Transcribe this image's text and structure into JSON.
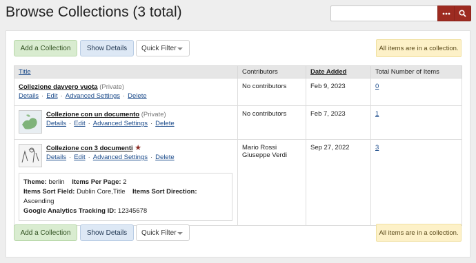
{
  "header": {
    "title": "Browse Collections (3 total)",
    "search_placeholder": "",
    "more_icon": "ellipsis-icon",
    "search_icon": "search-icon",
    "accent": "#9d2b21"
  },
  "toolbar": {
    "add_label": "Add a Collection",
    "show_label": "Show Details",
    "filter_label": "Quick Filter",
    "notice": "All items are in a collection."
  },
  "table": {
    "headers": [
      "Title",
      "Contributors",
      "Date Added",
      "Total Number of Items"
    ],
    "rows": [
      {
        "title": "Collezione davvero vuota",
        "private": "(Private)",
        "actions": [
          "Details",
          "Edit",
          "Advanced Settings",
          "Delete"
        ],
        "contributors": "No contributors",
        "date": "Feb 9, 2023",
        "count": "0"
      },
      {
        "title": "Collezione con un documento",
        "private": "(Private)",
        "actions": [
          "Details",
          "Edit",
          "Advanced Settings",
          "Delete"
        ],
        "contributors": "No contributors",
        "date": "Feb 7, 2023",
        "count": "1"
      },
      {
        "title": "Collezione con 3 documenti",
        "actions": [
          "Details",
          "Edit",
          "Advanced Settings",
          "Delete"
        ],
        "contributors_1": "Mario Rossi",
        "contributors_2": "Giuseppe Verdi",
        "date": "Sep 27, 2022",
        "count": "3",
        "details": {
          "theme_label": "Theme:",
          "theme_value": "berlin",
          "per_page_label": "Items Per Page:",
          "per_page_value": "2",
          "sort_field_label": "Items Sort Field:",
          "sort_field_value": "Dublin Core,Title",
          "sort_dir_label": "Items Sort Direction:",
          "sort_dir_value": "Ascending",
          "ga_label": "Google Analytics Tracking ID:",
          "ga_value": "12345678"
        }
      }
    ]
  }
}
